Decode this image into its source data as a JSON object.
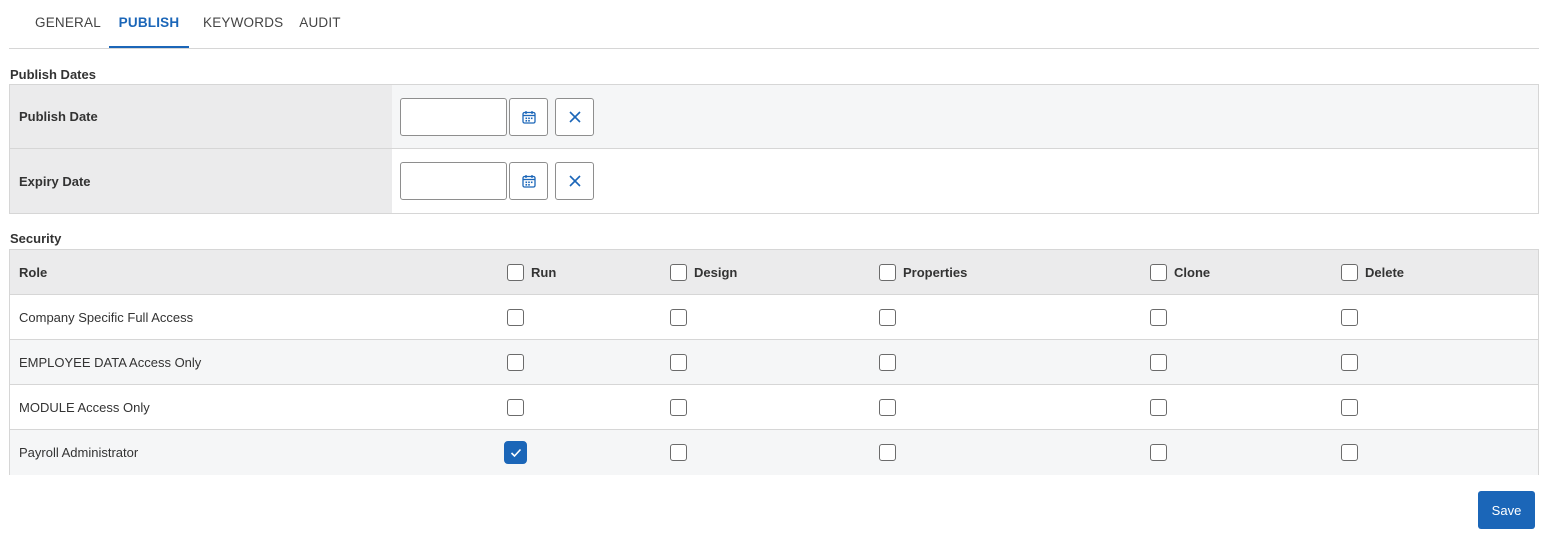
{
  "tabs": [
    {
      "label": "GENERAL",
      "active": false
    },
    {
      "label": "PUBLISH",
      "active": true
    },
    {
      "label": "KEYWORDS",
      "active": false
    },
    {
      "label": "AUDIT",
      "active": false
    }
  ],
  "publish_dates": {
    "title": "Publish Dates",
    "rows": [
      {
        "label": "Publish Date",
        "value": ""
      },
      {
        "label": "Expiry Date",
        "value": ""
      }
    ],
    "calendar_icon": "calendar-icon",
    "clear_icon": "close-icon"
  },
  "security": {
    "title": "Security",
    "role_header": "Role",
    "permissions": [
      "Run",
      "Design",
      "Properties",
      "Clone",
      "Delete"
    ],
    "rows": [
      {
        "role": "Company Specific Full Access",
        "checked": [
          false,
          false,
          false,
          false,
          false
        ]
      },
      {
        "role": "EMPLOYEE DATA Access Only",
        "checked": [
          false,
          false,
          false,
          false,
          false
        ]
      },
      {
        "role": "MODULE Access Only",
        "checked": [
          false,
          false,
          false,
          false,
          false
        ]
      },
      {
        "role": "Payroll Administrator",
        "checked": [
          true,
          false,
          false,
          false,
          false
        ]
      }
    ]
  },
  "save_label": "Save",
  "colors": {
    "accent": "#1b66b8",
    "border": "#d6d6d6",
    "header_bg": "#ebebec",
    "alt_row_bg": "#f5f6f7"
  }
}
